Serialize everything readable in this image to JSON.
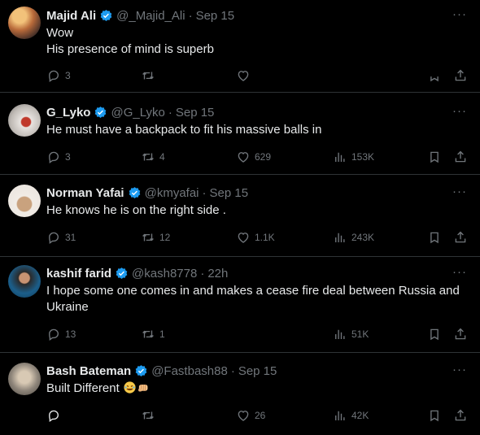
{
  "tweets": [
    {
      "name": "Majid Ali",
      "handle": "@_Majid_Ali",
      "time": "Sep 15",
      "lines": [
        "Wow",
        "His presence of mind is superb"
      ],
      "replies": "3",
      "retweets": "",
      "likes": "",
      "views": ""
    },
    {
      "name": "G_Lyko",
      "handle": "@G_Lyko",
      "time": "Sep 15",
      "lines": [
        "He must have a backpack to fit his massive balls in"
      ],
      "replies": "3",
      "retweets": "4",
      "likes": "629",
      "views": "153K"
    },
    {
      "name": "Norman Yafai",
      "handle": "@kmyafai",
      "time": "Sep 15",
      "lines": [
        "He knows he is on the right side ."
      ],
      "replies": "31",
      "retweets": "12",
      "likes": "1.1K",
      "views": "243K"
    },
    {
      "name": "kashif farid",
      "handle": "@kash8778",
      "time": "22h",
      "lines": [
        "I hope some one comes in and makes a cease fire deal between Russia and",
        "Ukraine"
      ],
      "replies": "13",
      "retweets": "1",
      "likes": "",
      "views": "51K"
    },
    {
      "name": "Bash Bateman",
      "handle": "@Fastbash88",
      "time": "Sep 15",
      "lines": [
        "Built Different"
      ],
      "replies": "",
      "retweets": "",
      "likes": "26",
      "views": "42K"
    }
  ],
  "separator": "·",
  "more": "···",
  "icons": {
    "reply": "reply-icon",
    "retweet": "retweet-icon",
    "like": "like-icon",
    "views": "views-icon",
    "bookmark": "bookmark-icon",
    "share": "share-icon",
    "verified": "verified-badge-icon",
    "emoji": [
      "rofl-emoji-icon",
      "fist-emoji-icon"
    ]
  },
  "colors": {
    "background": "#000000",
    "text": "#e7e9ea",
    "muted": "#71767b",
    "verified": "#1d9bf0",
    "divider": "#2f3336"
  }
}
